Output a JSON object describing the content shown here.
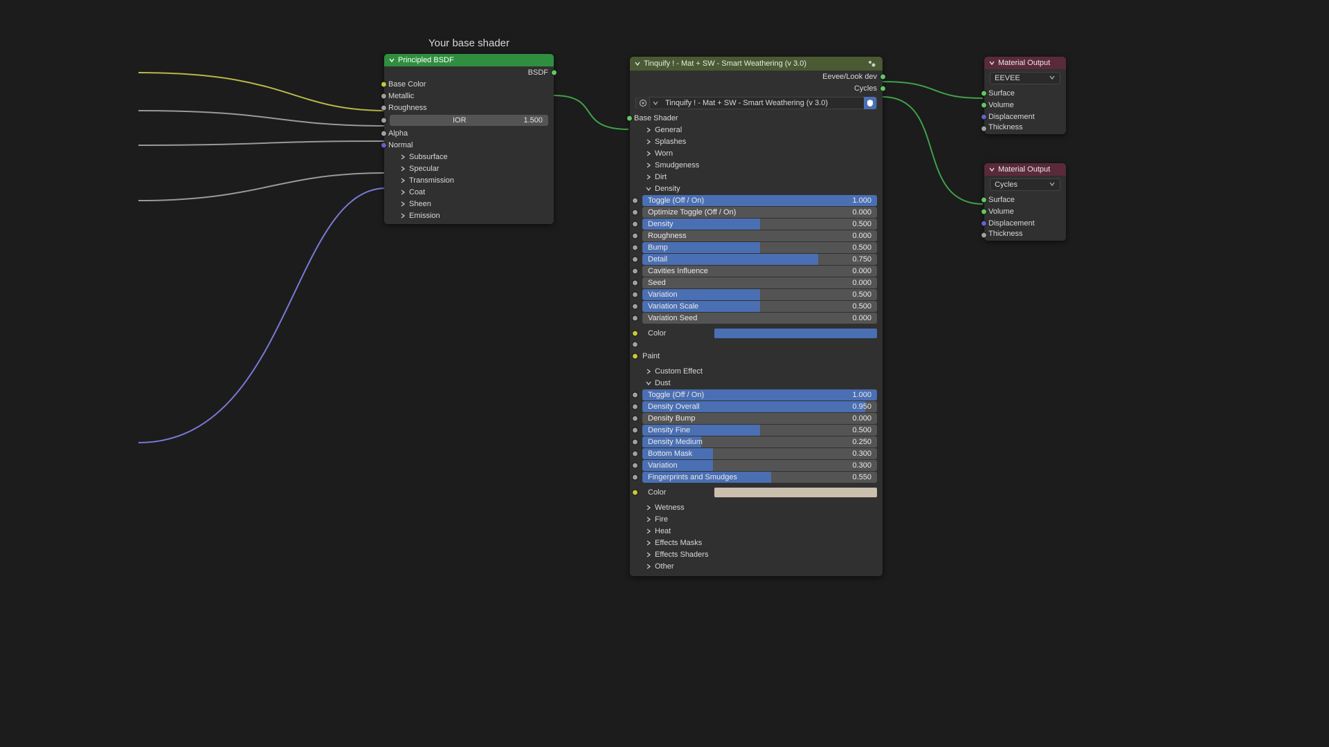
{
  "canvas_title": "Your base shader",
  "bsdf": {
    "header": "Principled BSDF",
    "output": "BSDF",
    "inputs": [
      "Base Color",
      "Metallic",
      "Roughness"
    ],
    "ior_label": "IOR",
    "ior_value": "1.500",
    "inputs2": [
      "Alpha",
      "Normal"
    ],
    "expands": [
      "Subsurface",
      "Specular",
      "Transmission",
      "Coat",
      "Sheen",
      "Emission"
    ]
  },
  "group": {
    "header": "Tinquify ! - Mat + SW - Smart Weathering (v 3.0)",
    "out_eevee": "Eevee/Look dev",
    "out_cycles": "Cycles",
    "ref_name": "Tinquify ! - Mat + SW - Smart Weathering (v 3.0)",
    "base_shader": "Base Shader",
    "cats_top": [
      "General",
      "Splashes",
      "Worn",
      "Smudgeness",
      "Dirt"
    ],
    "density_cat": "Density",
    "density_sliders": [
      {
        "name": "Toggle (Off / On)",
        "v": "1.000",
        "p": 100
      },
      {
        "name": "Optimize Toggle (Off / On)",
        "v": "0.000",
        "p": 0
      },
      {
        "name": "Density",
        "v": "0.500",
        "p": 50
      },
      {
        "name": "Roughness",
        "v": "0.000",
        "p": 0
      },
      {
        "name": "Bump",
        "v": "0.500",
        "p": 50
      },
      {
        "name": "Detail",
        "v": "0.750",
        "p": 75
      },
      {
        "name": "Cavities Influence",
        "v": "0.000",
        "p": 0
      },
      {
        "name": "Seed",
        "v": "0.000",
        "p": 0
      },
      {
        "name": "Variation",
        "v": "0.500",
        "p": 50
      },
      {
        "name": "Variation Scale",
        "v": "0.500",
        "p": 50
      },
      {
        "name": "Variation Seed",
        "v": "0.000",
        "p": 0
      }
    ],
    "density_color_label": "Color",
    "density_color_hex": "#4a6fb3",
    "paint_label": "Paint",
    "custom_effect": "Custom Effect",
    "dust_cat": "Dust",
    "dust_sliders": [
      {
        "name": "Toggle (Off / On)",
        "v": "1.000",
        "p": 100
      },
      {
        "name": "Density Overall",
        "v": "0.950",
        "p": 95
      },
      {
        "name": "Density Bump",
        "v": "0.000",
        "p": 0
      },
      {
        "name": "Density Fine",
        "v": "0.500",
        "p": 50
      },
      {
        "name": "Density Medium",
        "v": "0.250",
        "p": 25
      },
      {
        "name": "Bottom Mask",
        "v": "0.300",
        "p": 30
      },
      {
        "name": "Variation",
        "v": "0.300",
        "p": 30
      },
      {
        "name": "Fingerprints and Smudges",
        "v": "0.550",
        "p": 55
      }
    ],
    "dust_color_label": "Color",
    "dust_color_hex": "#cbbfae",
    "cats_bottom": [
      "Wetness",
      "Fire",
      "Heat",
      "Effects Masks",
      "Effects Shaders",
      "Other"
    ]
  },
  "outA": {
    "header": "Material Output",
    "engine": "EEVEE",
    "rows": [
      "Surface",
      "Volume",
      "Displacement",
      "Thickness"
    ]
  },
  "outB": {
    "header": "Material Output",
    "engine": "Cycles",
    "rows": [
      "Surface",
      "Volume",
      "Displacement",
      "Thickness"
    ]
  }
}
